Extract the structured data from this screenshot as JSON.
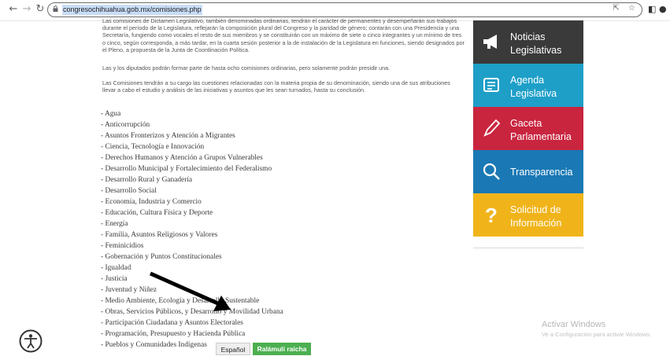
{
  "browser": {
    "url": "congresochihuahua.gob.mx/comisiones.php"
  },
  "content": {
    "paragraphs": [
      "Las comisiones de Dictamen Legislativo, también denominadas ordinarias, tendrán el carácter de permanentes y desempeñarán sus trabajos durante el período de la Legislatura, reflejarán la composición plural del Congreso y la paridad de género; contarán con una Presidencia y una Secretaría, fungiendo como vocales el resto de sus miembros y se constituirán con un máximo de siete o cinco integrantes y un mínimo de tres o cinco, según corresponda, a más tardar, en la cuarta sesión posterior a la de instalación de la Legislatura en funciones, siendo designados por el Pleno, a propuesta de la Junta de Coordinación Política.",
      "Las y los diputados podrán formar parte de hasta ocho comisiones ordinarias, pero solamente podrán presidir una.",
      "Las Comisiones tendrán a su cargo las cuestiones relacionadas con la materia propia de su denominación, siendo una de sus atribuciones llevar a cabo el estudio y análisis de las iniciativas y asuntos que les sean turnados, hasta su conclusión."
    ],
    "commissions": [
      "- Agua",
      "- Anticorrupción",
      "- Asuntos Fronterizos y Atención a Migrantes",
      "- Ciencia, Tecnología e Innovación",
      "- Derechos Humanos y Atención a Grupos Vulnerables",
      "- Desarrollo Municipal y Fortalecimiento del Federalismo",
      "- Desarrollo Rural y Ganadería",
      "- Desarrollo Social",
      "- Economía, Industria y Comercio",
      "- Educación, Cultura Física y Deporte",
      "- Energía",
      "- Familia, Asuntos Religiosos y Valores",
      "- Feminicidios",
      "- Gobernación y Puntos Constitucionales",
      "- Igualdad",
      "- Justicia",
      "- Juventud y Niñez",
      "- Medio Ambiente, Ecología y Desarrollo Sustentable",
      "- Obras, Servicios Públicos, y Desarrollo y Movilidad Urbana",
      "- Participación Ciudadana y Asuntos Electorales",
      "- Programación, Presupuesto y Hacienda Pública",
      "- Pueblos y Comunidades Indígenas"
    ]
  },
  "sidebar": [
    {
      "label_1": "Noticias",
      "label_2": "Legislativas",
      "icon": "megaphone-icon",
      "color": "#3a3a3a"
    },
    {
      "label_1": "Agenda",
      "label_2": "Legislativa",
      "icon": "agenda-icon",
      "color": "#1e9fc8"
    },
    {
      "label_1": "Gaceta",
      "label_2": "Parlamentaria",
      "icon": "pen-icon",
      "color": "#c9253f"
    },
    {
      "label_1": "Transparencia",
      "label_2": "",
      "icon": "search-icon",
      "color": "#1a79b5"
    },
    {
      "label_1": "Solicitud de",
      "label_2": "Información",
      "icon": "question-icon",
      "color": "#f0b41a"
    }
  ],
  "language": {
    "spanish": "Español",
    "raramuri": "Ralámuli raicha"
  },
  "watermark": {
    "title": "Activar Windows",
    "subtitle": "Ve a Configuración para activar Windows."
  }
}
